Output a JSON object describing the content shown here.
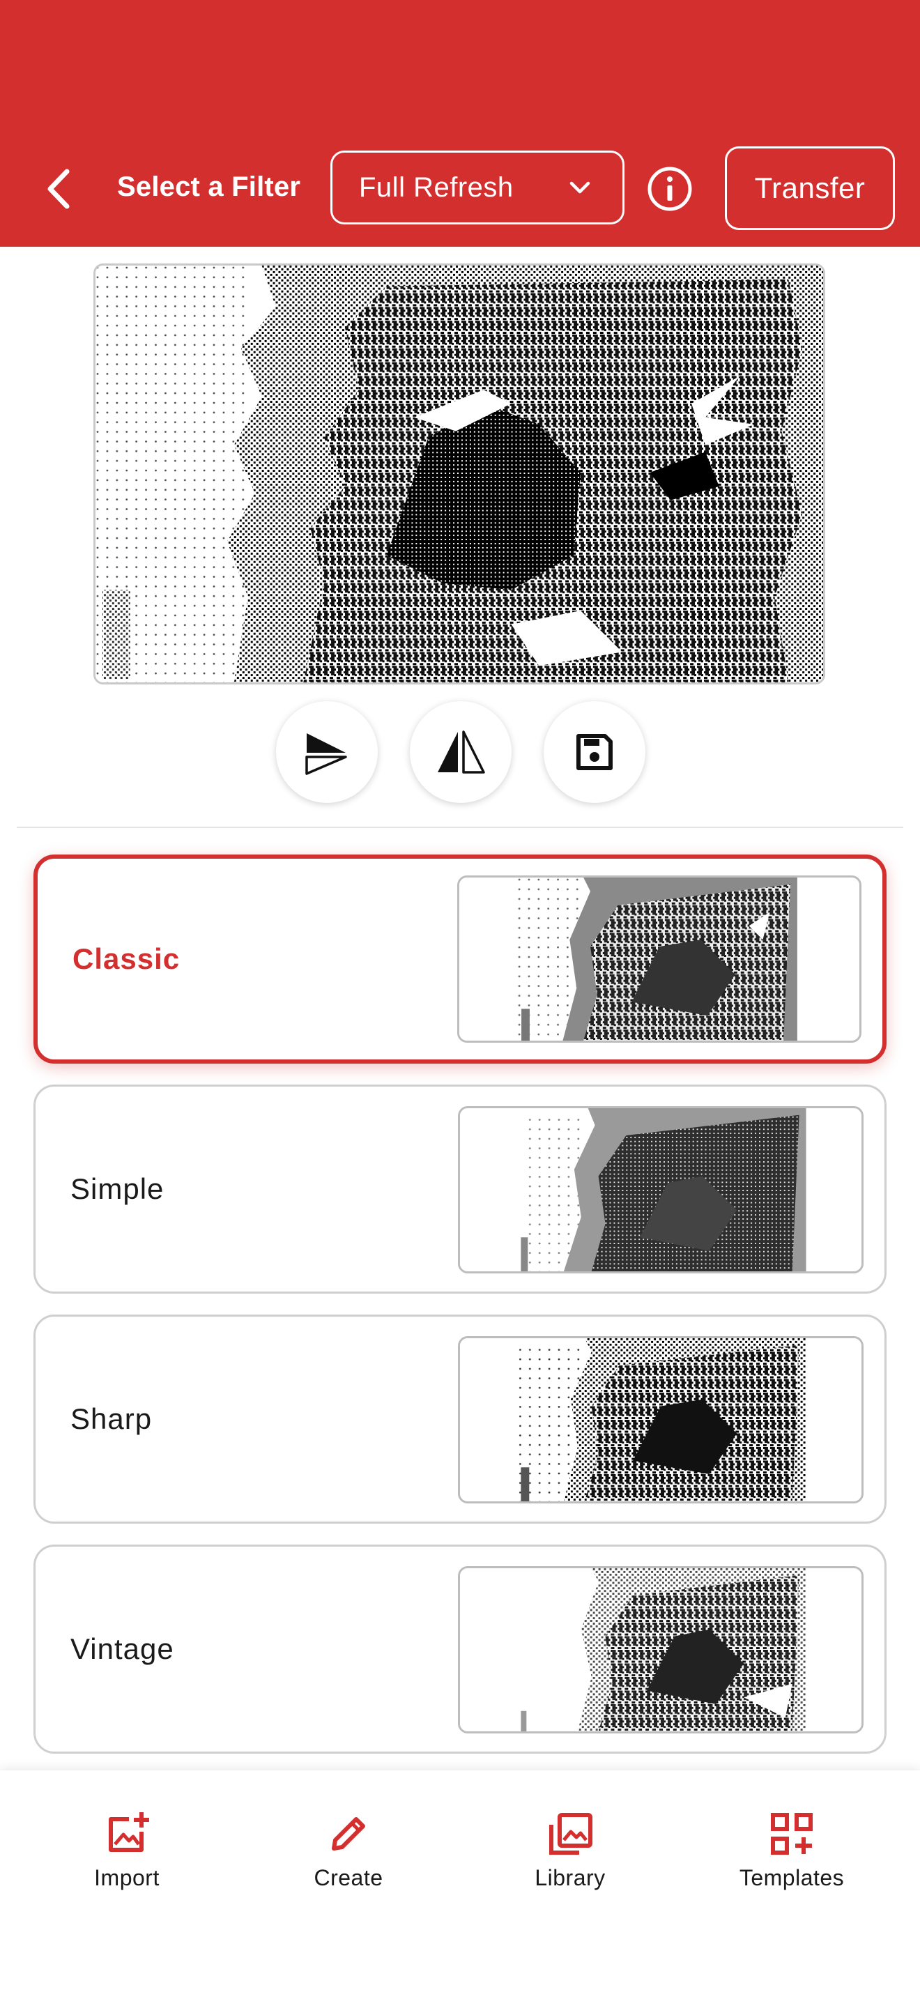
{
  "header": {
    "title": "Select a Filter",
    "refresh_mode": "Full Refresh",
    "transfer_label": "Transfer",
    "background_color": "#d32f2f"
  },
  "actions": [
    {
      "name": "rotate",
      "icon": "rotate-flip-icon"
    },
    {
      "name": "mirror",
      "icon": "mirror-icon"
    },
    {
      "name": "save",
      "icon": "save-icon"
    }
  ],
  "filters": [
    {
      "label": "Classic",
      "selected": true
    },
    {
      "label": "Simple",
      "selected": false
    },
    {
      "label": "Sharp",
      "selected": false
    },
    {
      "label": "Vintage",
      "selected": false
    }
  ],
  "bottom_nav": [
    {
      "label": "Import",
      "icon": "add-image-icon"
    },
    {
      "label": "Create",
      "icon": "pencil-icon"
    },
    {
      "label": "Library",
      "icon": "image-library-icon"
    },
    {
      "label": "Templates",
      "icon": "grid-plus-icon"
    }
  ],
  "accent_color": "#d32f2f"
}
